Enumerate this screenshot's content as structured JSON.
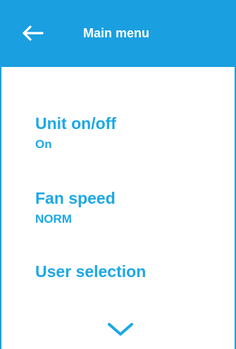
{
  "header": {
    "title": "Main menu",
    "back_icon": "arrow-left-icon",
    "background_color": "#1a9fe0"
  },
  "menu": {
    "items": [
      {
        "label": "Unit on/off",
        "value": "On"
      },
      {
        "label": "Fan speed",
        "value": "NORM"
      },
      {
        "label": "User selection"
      }
    ]
  },
  "scroll": {
    "icon": "chevron-down-icon"
  },
  "colors": {
    "accent": "#1ca8e6",
    "header_text": "#ffffff"
  }
}
